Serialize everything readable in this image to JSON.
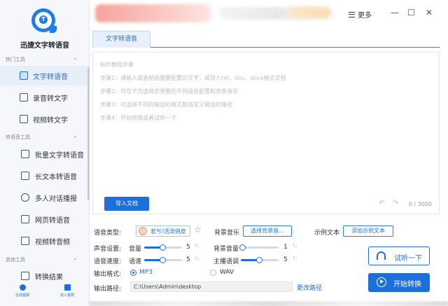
{
  "app": {
    "name": "迅捷文字转语音",
    "logo_icon": "app-logo-icon",
    "logo_letter": "T",
    "accent": "#1e6fd9"
  },
  "sidebar": {
    "groups": [
      {
        "label": "热门工具",
        "items": [
          "文字转语音",
          "录音转文字",
          "视频转文字"
        ]
      },
      {
        "label": "转语音工具",
        "items": [
          "批量文字转语音",
          "长文本转语音",
          "多人对话播报",
          "网页转语音",
          "视频转音频"
        ]
      },
      {
        "label": "其他工具",
        "items": [
          "转换结果"
        ]
      }
    ],
    "active_item": "文字转语音",
    "bottom_links": [
      "在线客服",
      "进入官网"
    ]
  },
  "titlebar": {
    "more_label": "更多",
    "min": "—",
    "max": "☐",
    "close": "✕"
  },
  "tabs": [
    {
      "label": "文字转语音",
      "active": true
    }
  ],
  "editor": {
    "placeholder_lines": [
      "制作教程步骤",
      "步骤1：请输入或者粘贴需要配置的文字，或导入txt、doc、docx格式文档",
      "步骤2：可在下方选择您想要的不同语音配置和背景音乐",
      "步骤3：可选择不同的输出的格式和自定义输出的路径",
      "步骤4：开始转换或者试听一下"
    ],
    "import_label": "导入文档",
    "char_count": "0 / 3000"
  },
  "settings": {
    "voice_type_label": "语音类型:",
    "voice_name": "若兮/活泼俏皮",
    "bgm_label": "背景音乐",
    "bgm_button": "选择背景音...",
    "example_label": "示例文本",
    "example_button": "添加示例文本",
    "sound_label": "声音设置:",
    "speed_label": "语音速度:",
    "sliders": [
      {
        "label": "音量",
        "value": "5",
        "fraction": 0.5
      },
      {
        "label": "语速",
        "value": "5",
        "fraction": 0.5
      },
      {
        "label": "背景音量",
        "value": "1",
        "fraction": 0.0
      },
      {
        "label": "主播语调",
        "value": "5",
        "fraction": 0.5
      }
    ],
    "format_label": "输出格式:",
    "formats": [
      {
        "label": "MP3",
        "selected": true
      },
      {
        "label": "WAV",
        "selected": false
      }
    ],
    "path_label": "输出路径:",
    "path_value": "C:\\Users\\Admin\\desktop",
    "change_path": "更改路径"
  },
  "actions": {
    "listen": "试听一下",
    "start": "开始转换"
  }
}
